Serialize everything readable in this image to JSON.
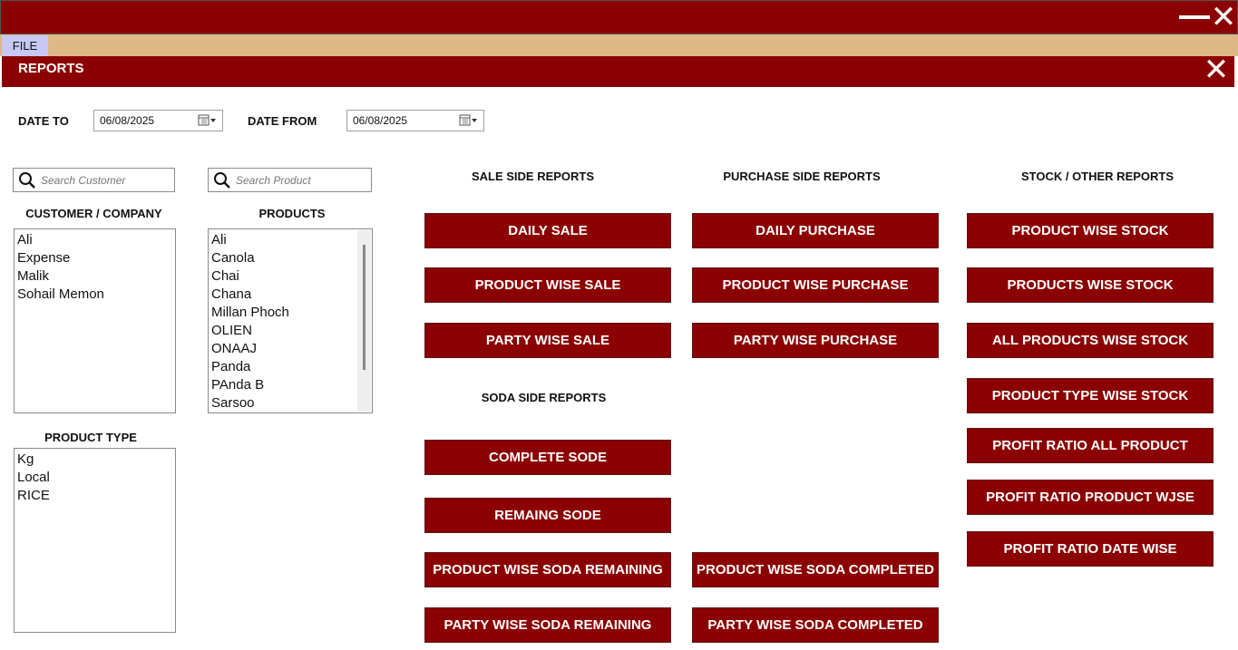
{
  "window": {
    "minimize_label": "—",
    "close_label": "✕"
  },
  "menu": {
    "file_label": "FILE"
  },
  "reports": {
    "title": "REPORTS",
    "close_label": "✕"
  },
  "filters": {
    "date_to_label": "DATE TO",
    "date_to_value": "06/08/2025",
    "date_from_label": "DATE FROM",
    "date_from_value": "06/08/2025"
  },
  "customer": {
    "search_placeholder": "Search Customer",
    "heading": "CUSTOMER / COMPANY",
    "items": [
      "Ali",
      "Expense",
      "Malik",
      "Sohail Memon"
    ]
  },
  "products": {
    "search_placeholder": "Search Product",
    "heading": "PRODUCTS",
    "items": [
      "Ali",
      "Canola",
      "Chai",
      "Chana",
      "Millan Phoch",
      "OLIEN",
      "ONAAJ",
      "Panda",
      "PAnda B",
      "Sarsoo"
    ]
  },
  "product_type": {
    "heading": "PRODUCT TYPE",
    "items": [
      "Kg",
      "Local",
      "RICE"
    ]
  },
  "sections": {
    "sale": "SALE SIDE REPORTS",
    "purchase": "PURCHASE SIDE REPORTS",
    "stock": "STOCK / OTHER REPORTS",
    "soda": "SODA SIDE REPORTS"
  },
  "buttons": {
    "daily_sale": "DAILY SALE",
    "product_wise_sale": "PRODUCT WISE SALE",
    "party_wise_sale": "PARTY WISE SALE",
    "daily_purchase": "DAILY PURCHASE",
    "product_wise_purchase": "PRODUCT WISE PURCHASE",
    "party_wise_purchase": "PARTY WISE PURCHASE",
    "product_wise_stock": "PRODUCT WISE STOCK",
    "products_wise_stock": "PRODUCTS WISE STOCK",
    "all_products_wise_stock": "ALL PRODUCTS WISE STOCK",
    "product_type_wise_stock": "PRODUCT TYPE WISE STOCK",
    "profit_ratio_all_product": "PROFIT RATIO ALL PRODUCT",
    "profit_ratio_product_wise": "PROFIT RATIO PRODUCT WJSE",
    "profit_ratio_date_wise": "PROFIT RATIO DATE WISE",
    "complete_sode": "COMPLETE SODE",
    "remaing_sode": "REMAING SODE",
    "product_wise_soda_remaining": "PRODUCT WISE SODA REMAINING",
    "product_wise_soda_completed": "PRODUCT WISE SODA COMPLETED",
    "party_wise_soda_remaining": "PARTY WISE SODA REMAINING",
    "party_wise_soda_completed": "PARTY WISE SODA COMPLETED"
  },
  "colors": {
    "primary": "#8b0000",
    "menubar": "#deb887",
    "file_menu": "#c8c8f6"
  },
  "icons": {
    "search": "search-icon",
    "calendar": "calendar-icon",
    "close": "close-icon",
    "minimize": "minimize-icon"
  }
}
